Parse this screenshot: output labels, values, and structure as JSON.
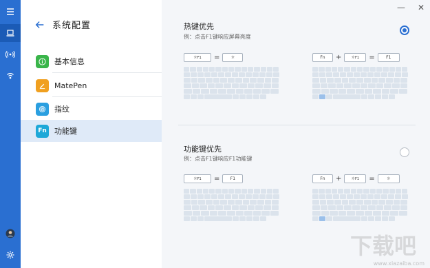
{
  "rail": {
    "items": [
      {
        "icon": "menu-icon"
      },
      {
        "icon": "laptop-icon"
      },
      {
        "icon": "broadcast-icon"
      },
      {
        "icon": "signal-icon"
      }
    ],
    "bottom": [
      {
        "icon": "avatar"
      },
      {
        "icon": "gear-icon"
      }
    ]
  },
  "nav": {
    "title": "系统配置",
    "items": [
      {
        "label": "基本信息",
        "icon": "info-icon",
        "color": "#3ab54a"
      },
      {
        "label": "MatePen",
        "icon": "pen-icon",
        "color": "#f0a020"
      },
      {
        "label": "指纹",
        "icon": "fingerprint-icon",
        "color": "#2a9fe0"
      },
      {
        "label": "功能键",
        "icon_text": "Fn",
        "color": "#1ea8d8"
      }
    ]
  },
  "window": {
    "minimize": "—",
    "close": "✕"
  },
  "sections": [
    {
      "title": "热键优先",
      "desc": "例：点击F1键响应屏幕亮度",
      "checked": true,
      "left_combo": {
        "key1": "F1",
        "result": "☼"
      },
      "right_combo": {
        "key1": "Fn",
        "key2": "F1",
        "result": "F1"
      }
    },
    {
      "title": "功能键优先",
      "desc": "例：点击F1键响应F1功能键",
      "checked": false,
      "left_combo": {
        "key1": "F1",
        "result": "F1"
      },
      "right_combo": {
        "key1": "Fn",
        "key2": "F1",
        "result": "☼"
      }
    }
  ],
  "operators": {
    "equals": "=",
    "plus": "+"
  },
  "watermark": {
    "text": "下载吧",
    "url": "www.xiazaiba.com"
  },
  "accent": "#2a6fd1"
}
